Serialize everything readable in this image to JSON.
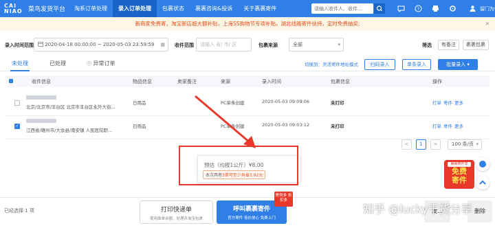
{
  "header": {
    "logo_mark": "CAI NIAO",
    "logo_name": "菜鸟发货平台",
    "nav": [
      "淘系订单处理",
      "录入订单处理",
      "包裹状态",
      "裹裹咨询&投诉",
      "关于裹裹寄件"
    ],
    "active_nav": 1,
    "search_placeholder": "请输入收件人、收件...",
    "user": "留门为你"
  },
  "notice": {
    "text": "新商家免费寄，淘宝新店超大额补贴，上海SS购物节专项补贴，湖北线路寄件扶持，定时免费抽奖;"
  },
  "filters": {
    "time_label": "录入时间范围",
    "start": "2020-04-18 00:00:00",
    "sep": "~",
    "end": "2020-05-03 23:59:59",
    "region_label": "收件范围",
    "region_placeholder": "请输入 省/ 市/ 区",
    "source_label": "包裹来源",
    "source_value": "全部",
    "filter_label": "筛选",
    "btn_remark": "有备注",
    "btn_package": "裹裹包裹"
  },
  "tabs": {
    "items": [
      "未处理",
      "已处理",
      "异常订单"
    ],
    "active": 0
  },
  "actions": {
    "switch_link": "切换到：灵活寄件地址模式",
    "scan": "扫码录入",
    "single": "单条录入",
    "batch": "批量录入"
  },
  "table": {
    "headers": [
      "收件信息",
      "物品信息",
      "卖家备注",
      "来源",
      "录入时间",
      "包裹信息",
      "操作"
    ],
    "rows": [
      {
        "address": "北京/北京市/丰台区 北京市丰台区永外大街...",
        "item": "日用品",
        "remark": "",
        "source": "PC单条创建",
        "time": "2020-05-03 09:09:06",
        "status": "未打印",
        "ops": [
          "打单",
          "寄件",
          "更多"
        ],
        "checked": false
      },
      {
        "address": "江西省/赣州市/大余县/南安镇 人民医院职...",
        "item": "日用品",
        "remark": "",
        "source": "PC单条创建",
        "time": "2020-05-03 09:03:12",
        "status": "未打印",
        "ops": [
          "打单",
          "寄件",
          "更多"
        ],
        "checked": true
      }
    ]
  },
  "pager": {
    "prev": "<",
    "current": "1",
    "next": ">",
    "size": "100 条/页"
  },
  "popup": {
    "main": "预估（均按1公斤）¥8.00",
    "sub_prefix": "本次两者",
    "sub_hl1": "3单可至少共省",
    "sub_hl2": "3.92元"
  },
  "promo": {
    "top": "裹裹寄件享",
    "line1": "免费",
    "line2": "寄件"
  },
  "bottom": {
    "selected": "已经选择 1 项",
    "print_title": "打印快递单",
    "print_sub": "使用面单余额、处理并淘宝包裹",
    "pickup_title": "呼叫裹裹寄件",
    "pickup_sub": "官方寄件 低价放心 免费上门",
    "badge": "寄得多 折扣多",
    "btn_mid": "发...",
    "btn_right": "删除"
  },
  "watermark": "知乎 @lucky干货分享"
}
